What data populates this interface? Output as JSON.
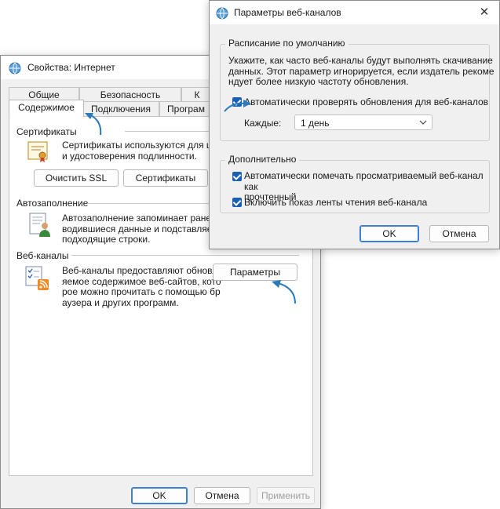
{
  "main_window": {
    "title": "Свойства: Интернет",
    "tabs_row1": [
      "Общие",
      "Безопасность",
      "К"
    ],
    "tabs_row2": [
      "Содержимое",
      "Подключения",
      "Програм"
    ],
    "certificates": {
      "heading": "Сертификаты",
      "text": [
        "Сертификаты используются для шиф",
        "и удостоверения подлинности."
      ],
      "clear_ssl": "Очистить SSL",
      "certs_button": "Сертификаты"
    },
    "autocomplete": {
      "heading": "Автозаполнение",
      "text": [
        "Автозаполнение запоминает ранее в",
        "водившиеся данные и подставляет",
        "подходящие строки."
      ]
    },
    "feeds": {
      "heading": "Веб-каналы",
      "text": [
        "Веб-каналы предоставляют обновл",
        "яемое содержимое веб-сайтов, кото",
        "рое можно прочитать с помощью бр",
        "аузера и других программ."
      ],
      "settings_button": "Параметры"
    },
    "footer": {
      "ok": "OK",
      "cancel": "Отмена",
      "apply": "Применить"
    }
  },
  "dialog": {
    "title": "Параметры веб-каналов",
    "schedule": {
      "legend": "Расписание по умолчанию",
      "text": [
        "Укажите, как часто веб-каналы будут выполнять скачивание",
        "данных. Этот параметр игнорируется, если издатель рекоме",
        "ндует более низкую частоту обновления."
      ],
      "auto_check_label": "Автоматически проверять обновления для веб-каналов",
      "auto_check_checked": true,
      "every_label": "Каждые:",
      "every_value": "1 день"
    },
    "advanced": {
      "legend": "Дополнительно",
      "mark_read_label": [
        "Автоматически помечать просматриваемый веб-канал как",
        "прочтенный"
      ],
      "mark_read_checked": true,
      "reading_view_label": "Включить показ ленты чтения веб-канала",
      "reading_view_checked": true
    },
    "ok": "OK",
    "cancel": "Отмена"
  },
  "colors": {
    "accent": "#1a5fb4",
    "arrow": "#2a7bb8"
  }
}
